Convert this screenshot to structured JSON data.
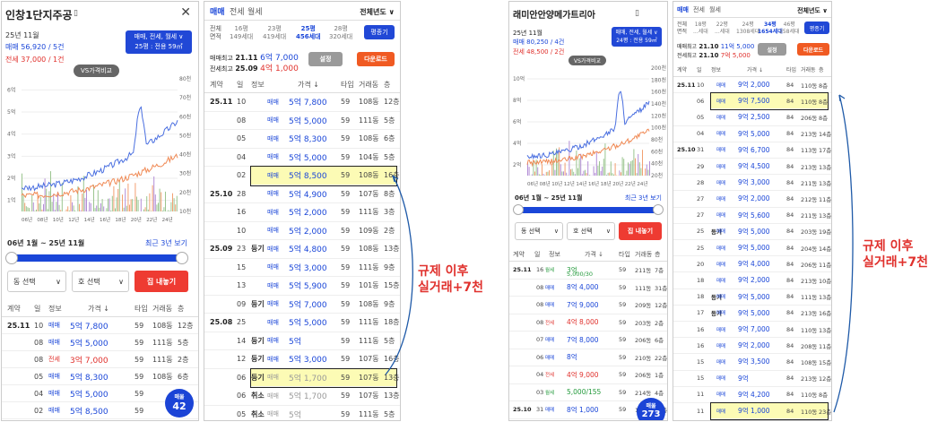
{
  "p1": {
    "title": "인창1단지주공",
    "date": "25년 11월",
    "sale_label": "매매",
    "sale": "56,920 / 5건",
    "rent_label": "전세",
    "rent": "37,000 / 1건",
    "filter_line1": "매매, 전세, 월세 ∨",
    "filter_line2": "25평 : 전용 59㎡",
    "vs": "VS가격비교",
    "y_left": [
      "6억",
      "5억",
      "4억",
      "3억",
      "2억",
      "1억"
    ],
    "y_right": [
      "80천",
      "70천",
      "60천",
      "50천",
      "40천",
      "30천",
      "20천",
      "10천"
    ],
    "x": [
      "06년",
      "08년",
      "10년",
      "12년",
      "14년",
      "16년",
      "18년",
      "20년",
      "22년",
      "24년"
    ],
    "period": "06년 1월 ~ 25년 11월",
    "recent": "최근 3년 보기",
    "dong": "동 선택",
    "ho": "호 선택",
    "notify": "집 내놓기",
    "hdr": [
      "계약",
      "일",
      "정보",
      "가격 ↓",
      "타입",
      "거래동",
      "층"
    ],
    "badge_top": "매물",
    "badge_num": "42",
    "rows": [
      {
        "c": "25.11",
        "d": "10",
        "i": "",
        "t": "매매",
        "p": "5억 7,800",
        "ty": "59",
        "b": "108동",
        "f": "12층",
        "cls": "blue"
      },
      {
        "c": "",
        "d": "08",
        "i": "",
        "t": "매매",
        "p": "5억 5,000",
        "ty": "59",
        "b": "111동",
        "f": "5층",
        "cls": "blue"
      },
      {
        "c": "",
        "d": "08",
        "i": "",
        "t": "전세",
        "p": "3억 7,000",
        "ty": "59",
        "b": "111동",
        "f": "2층",
        "cls": "red"
      },
      {
        "c": "",
        "d": "05",
        "i": "",
        "t": "매매",
        "p": "5억 8,300",
        "ty": "59",
        "b": "108동",
        "f": "6층",
        "cls": "blue"
      },
      {
        "c": "",
        "d": "04",
        "i": "",
        "t": "매매",
        "p": "5억 5,000",
        "ty": "59",
        "b": "",
        "f": "",
        "cls": "blue"
      },
      {
        "c": "",
        "d": "02",
        "i": "",
        "t": "매매",
        "p": "5억 8,500",
        "ty": "59",
        "b": "",
        "f": "",
        "cls": "blue"
      }
    ]
  },
  "p2": {
    "tabs": [
      "매매",
      "전세",
      "월세"
    ],
    "year": "전체년도 ∨",
    "area_label": "전체",
    "area_sub": "면적",
    "sizes": [
      {
        "a": "16평",
        "b": "149세대"
      },
      {
        "a": "23평",
        "b": "419세대"
      },
      {
        "a": "25평",
        "b": "456세대"
      },
      {
        "a": "28평",
        "b": "320세대"
      }
    ],
    "map": "평종기",
    "max1_label": "매매최고",
    "max1_date": "21.11",
    "max1": "6억 7,000",
    "max2_label": "전세최고",
    "max2_date": "25.09",
    "max2": "4억 1,000",
    "set": "설정",
    "dl": "다운로드",
    "hdr": [
      "계약",
      "일",
      "정보",
      "가격 ↓",
      "타입",
      "거래동",
      "층"
    ],
    "rows": [
      {
        "c": "25.11",
        "d": "10",
        "i": "",
        "t": "매매",
        "p": "5억 7,800",
        "ty": "59",
        "b": "108동",
        "f": "12층",
        "cls": "blue",
        "hl": false
      },
      {
        "c": "",
        "d": "08",
        "i": "",
        "t": "매매",
        "p": "5억 5,000",
        "ty": "59",
        "b": "111동",
        "f": "5층",
        "cls": "blue",
        "hl": false
      },
      {
        "c": "",
        "d": "05",
        "i": "",
        "t": "매매",
        "p": "5억 8,300",
        "ty": "59",
        "b": "108동",
        "f": "6층",
        "cls": "blue",
        "hl": false
      },
      {
        "c": "",
        "d": "04",
        "i": "",
        "t": "매매",
        "p": "5억 5,000",
        "ty": "59",
        "b": "104동",
        "f": "5층",
        "cls": "blue",
        "hl": false
      },
      {
        "c": "",
        "d": "02",
        "i": "",
        "t": "매매",
        "p": "5억 8,500",
        "ty": "59",
        "b": "108동",
        "f": "16층",
        "cls": "blue",
        "hl": true
      },
      {
        "c": "25.10",
        "d": "28",
        "i": "",
        "t": "매매",
        "p": "5억 4,900",
        "ty": "59",
        "b": "107동",
        "f": "8층",
        "cls": "blue",
        "hl": false
      },
      {
        "c": "",
        "d": "16",
        "i": "",
        "t": "매매",
        "p": "5억 2,000",
        "ty": "59",
        "b": "111동",
        "f": "3층",
        "cls": "blue",
        "hl": false
      },
      {
        "c": "",
        "d": "10",
        "i": "",
        "t": "매매",
        "p": "5억 2,000",
        "ty": "59",
        "b": "109동",
        "f": "2층",
        "cls": "blue",
        "hl": false
      },
      {
        "c": "25.09",
        "d": "23",
        "i": "등기",
        "t": "매매",
        "p": "5억 4,800",
        "ty": "59",
        "b": "108동",
        "f": "13층",
        "cls": "blue",
        "hl": false
      },
      {
        "c": "",
        "d": "15",
        "i": "",
        "t": "매매",
        "p": "5억 3,000",
        "ty": "59",
        "b": "111동",
        "f": "9층",
        "cls": "blue",
        "hl": false
      },
      {
        "c": "",
        "d": "13",
        "i": "",
        "t": "매매",
        "p": "5억 5,900",
        "ty": "59",
        "b": "101동",
        "f": "15층",
        "cls": "blue",
        "hl": false
      },
      {
        "c": "",
        "d": "09",
        "i": "등기",
        "t": "매매",
        "p": "5억 7,000",
        "ty": "59",
        "b": "108동",
        "f": "9층",
        "cls": "blue",
        "hl": false
      },
      {
        "c": "25.08",
        "d": "25",
        "i": "",
        "t": "매매",
        "p": "5억 5,000",
        "ty": "59",
        "b": "111동",
        "f": "18층",
        "cls": "blue",
        "hl": false
      },
      {
        "c": "",
        "d": "14",
        "i": "등기",
        "t": "매매",
        "p": "5억",
        "ty": "59",
        "b": "111동",
        "f": "5층",
        "cls": "blue",
        "hl": false
      },
      {
        "c": "",
        "d": "12",
        "i": "등기",
        "t": "매매",
        "p": "5억 3,000",
        "ty": "59",
        "b": "107동",
        "f": "16층",
        "cls": "blue",
        "hl": false
      },
      {
        "c": "",
        "d": "06",
        "i": "등기",
        "t": "매매",
        "p": "5억 1,700",
        "ty": "59",
        "b": "107동",
        "f": "13층",
        "cls": "gray",
        "hl": true
      },
      {
        "c": "",
        "d": "06",
        "i": "취소",
        "t": "매매",
        "p": "5억 1,700",
        "ty": "59",
        "b": "107동",
        "f": "13층",
        "cls": "gray",
        "hl": false
      },
      {
        "c": "",
        "d": "05",
        "i": "취소",
        "t": "매매",
        "p": "5억",
        "ty": "59",
        "b": "111동",
        "f": "5층",
        "cls": "gray",
        "hl": false
      }
    ]
  },
  "annot1": "규제 이후\n실거래+7천",
  "p3": {
    "title": "래미안안양메가트리아",
    "date": "25년 11월",
    "sale_label": "매매",
    "sale": "80,250 / 4건",
    "rent_label": "전세",
    "rent": "48,500 / 2건",
    "filter_line1": "매매, 전세, 월세 ∨",
    "filter_line2": "24평 : 전용 59㎡",
    "vs": "VS가격비교",
    "y_left": [
      "10억",
      "8억",
      "6억",
      "4억",
      "2억"
    ],
    "y_right": [
      "200천",
      "180천",
      "160천",
      "140천",
      "120천",
      "100천",
      "80천",
      "60천",
      "40천",
      "20천"
    ],
    "x": [
      "06년",
      "08년",
      "10년",
      "12년",
      "14년",
      "16년",
      "18년",
      "20년",
      "22년",
      "24년"
    ],
    "period": "06년 1월 ~ 25년 11월",
    "recent": "최근 3년 보기",
    "dong": "동 선택",
    "ho": "호 선택",
    "notify": "집 내놓기",
    "hdr": [
      "계약",
      "일",
      "정보",
      "가격 ↓",
      "타입",
      "거래동",
      "층"
    ],
    "badge_top": "매물",
    "badge_num": "273",
    "rows": [
      {
        "c": "25.11",
        "d": "16",
        "t": "월세",
        "p": "3억",
        "p2": "5,000/30",
        "ty": "59",
        "b": "211동",
        "f": "7층",
        "cls": "green"
      },
      {
        "c": "",
        "d": "08",
        "t": "매매",
        "p": "8억 4,000",
        "ty": "59",
        "b": "111동",
        "f": "31층",
        "cls": "blue"
      },
      {
        "c": "",
        "d": "08",
        "t": "매매",
        "p": "7억 9,000",
        "ty": "59",
        "b": "209동",
        "f": "12층",
        "cls": "blue"
      },
      {
        "c": "",
        "d": "08",
        "t": "전세",
        "p": "4억 8,000",
        "ty": "59",
        "b": "203동",
        "f": "2층",
        "cls": "red"
      },
      {
        "c": "",
        "d": "07",
        "t": "매매",
        "p": "7억 8,000",
        "ty": "59",
        "b": "206동",
        "f": "6층",
        "cls": "blue"
      },
      {
        "c": "",
        "d": "06",
        "t": "매매",
        "p": "8억",
        "ty": "59",
        "b": "210동",
        "f": "22층",
        "cls": "blue"
      },
      {
        "c": "",
        "d": "04",
        "t": "전세",
        "p": "4억 9,000",
        "ty": "59",
        "b": "206동",
        "f": "1층",
        "cls": "red"
      },
      {
        "c": "",
        "d": "03",
        "t": "월세",
        "p": "5,000/155",
        "ty": "59",
        "b": "214동",
        "f": "4층",
        "cls": "green"
      },
      {
        "c": "25.10",
        "d": "31",
        "t": "매매",
        "p": "8억 1,000",
        "ty": "59",
        "b": "110동",
        "f": "23층",
        "cls": "blue"
      },
      {
        "c": "",
        "d": "31",
        "t": "매매",
        "p": "8억",
        "ty": "59",
        "b": "",
        "f": "",
        "cls": "blue"
      }
    ]
  },
  "p4": {
    "tabs": [
      "매매",
      "전세",
      "월세"
    ],
    "year": "전체년도 ∨",
    "area_label": "전체",
    "area_sub": "면적",
    "sizes": [
      {
        "a": "18평",
        "b": "...세대"
      },
      {
        "a": "22평",
        "b": "...세대"
      },
      {
        "a": "24평",
        "b": "1308세대"
      },
      {
        "a": "34평",
        "b": "1654세대"
      },
      {
        "a": "46평",
        "b": "258세대"
      }
    ],
    "map": "평종기",
    "max1_label": "매매최고",
    "max1_date": "21.10",
    "max1": "11억 5,000",
    "max2_label": "전세최고",
    "max2_date": "21.10",
    "max2": "7억 5,000",
    "set": "설정",
    "dl": "다운로드",
    "hdr": [
      "계약",
      "일",
      "정보",
      "가격 ↓",
      "타입",
      "거래동",
      "층"
    ],
    "rows": [
      {
        "c": "25.11",
        "d": "10",
        "i": "",
        "p": "9억 2,000",
        "b": "110동",
        "f": "8층",
        "hl": false
      },
      {
        "c": "",
        "d": "06",
        "i": "",
        "p": "9억 7,500",
        "b": "110동",
        "f": "8층",
        "hl": true
      },
      {
        "c": "",
        "d": "05",
        "i": "",
        "p": "9억 2,500",
        "b": "206동",
        "f": "8층",
        "hl": false
      },
      {
        "c": "",
        "d": "04",
        "i": "",
        "p": "9억 5,000",
        "b": "213동",
        "f": "14층",
        "hl": false
      },
      {
        "c": "25.10",
        "d": "31",
        "i": "",
        "p": "9억 6,700",
        "b": "113동",
        "f": "17층",
        "hl": false
      },
      {
        "c": "",
        "d": "29",
        "i": "",
        "p": "9억 4,500",
        "b": "213동",
        "f": "13층",
        "hl": false
      },
      {
        "c": "",
        "d": "28",
        "i": "",
        "p": "9억 3,000",
        "b": "211동",
        "f": "13층",
        "hl": false
      },
      {
        "c": "",
        "d": "27",
        "i": "",
        "p": "9억 2,000",
        "b": "212동",
        "f": "11층",
        "hl": false
      },
      {
        "c": "",
        "d": "27",
        "i": "",
        "p": "9억 5,600",
        "b": "211동",
        "f": "13층",
        "hl": false
      },
      {
        "c": "",
        "d": "25",
        "i": "등기",
        "p": "9억 5,000",
        "b": "203동",
        "f": "19층",
        "hl": false
      },
      {
        "c": "",
        "d": "25",
        "i": "",
        "p": "9억 5,000",
        "b": "204동",
        "f": "14층",
        "hl": false
      },
      {
        "c": "",
        "d": "20",
        "i": "",
        "p": "9억 4,000",
        "b": "206동",
        "f": "11층",
        "hl": false
      },
      {
        "c": "",
        "d": "18",
        "i": "",
        "p": "9억 2,000",
        "b": "213동",
        "f": "10층",
        "hl": false
      },
      {
        "c": "",
        "d": "18",
        "i": "등기",
        "p": "9억 5,000",
        "b": "111동",
        "f": "13층",
        "hl": false
      },
      {
        "c": "",
        "d": "17",
        "i": "등기",
        "p": "9억 5,000",
        "b": "213동",
        "f": "16층",
        "hl": false
      },
      {
        "c": "",
        "d": "16",
        "i": "",
        "p": "9억 7,000",
        "b": "110동",
        "f": "13층",
        "hl": false
      },
      {
        "c": "",
        "d": "16",
        "i": "",
        "p": "9억 2,000",
        "b": "208동",
        "f": "11층",
        "hl": false
      },
      {
        "c": "",
        "d": "15",
        "i": "",
        "p": "9억 3,500",
        "b": "108동",
        "f": "15층",
        "hl": false
      },
      {
        "c": "",
        "d": "15",
        "i": "",
        "p": "9억",
        "b": "213동",
        "f": "12층",
        "hl": false
      },
      {
        "c": "",
        "d": "11",
        "i": "",
        "p": "9억 4,200",
        "b": "110동",
        "f": "8층",
        "hl": false
      },
      {
        "c": "",
        "d": "11",
        "i": "",
        "p": "9억 1,000",
        "b": "110동",
        "f": "23층",
        "hl": true
      }
    ]
  },
  "annot2": "규제 이후\n실거래+7천"
}
